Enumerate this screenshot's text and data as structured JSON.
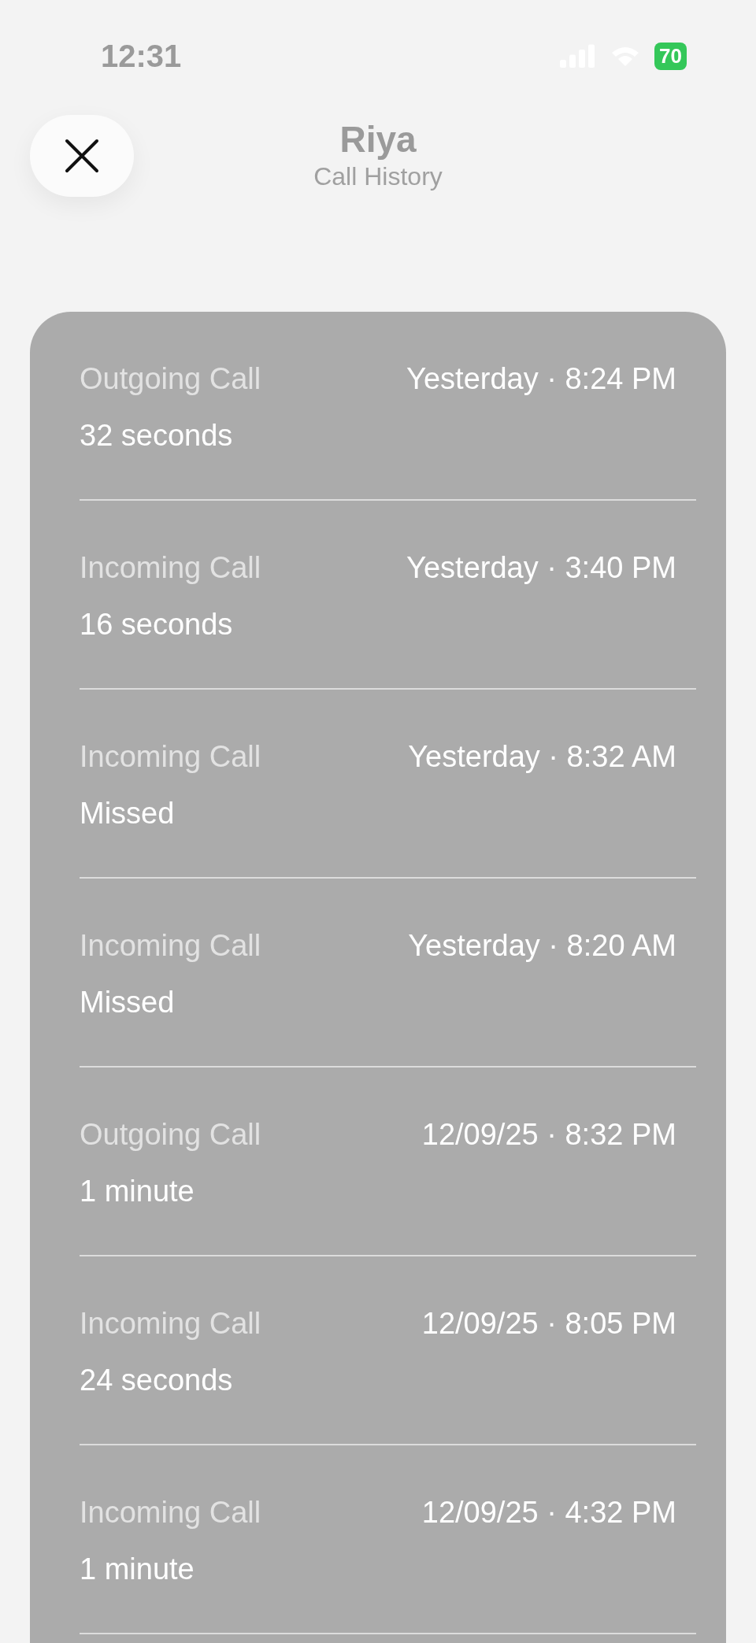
{
  "status_bar": {
    "time": "12:31",
    "battery": "70"
  },
  "header": {
    "title": "Riya",
    "subtitle": "Call History"
  },
  "calls": [
    {
      "type": "Outgoing Call",
      "when": "Yesterday · 8:24 PM",
      "detail": "32 seconds"
    },
    {
      "type": "Incoming Call",
      "when": "Yesterday · 3:40 PM",
      "detail": "16 seconds"
    },
    {
      "type": "Incoming Call",
      "when": "Yesterday · 8:32 AM",
      "detail": "Missed"
    },
    {
      "type": "Incoming Call",
      "when": "Yesterday · 8:20 AM",
      "detail": "Missed"
    },
    {
      "type": "Outgoing Call",
      "when": "12/09/25 · 8:32 PM",
      "detail": "1 minute"
    },
    {
      "type": "Incoming Call",
      "when": "12/09/25 · 8:05 PM",
      "detail": "24 seconds"
    },
    {
      "type": "Incoming Call",
      "when": "12/09/25 · 4:32 PM",
      "detail": "1 minute"
    }
  ]
}
